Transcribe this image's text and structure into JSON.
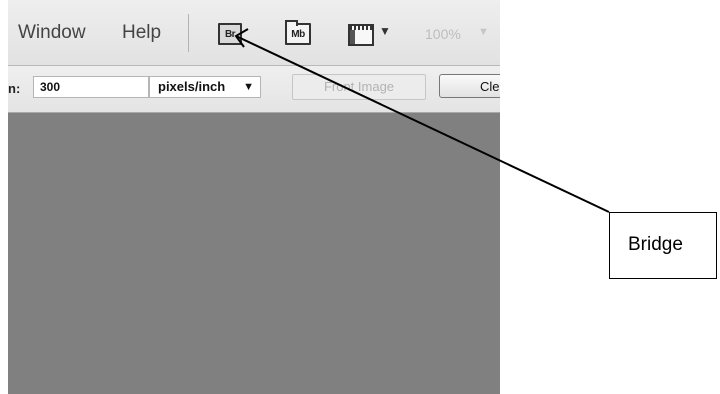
{
  "menu": {
    "window_label": "Window",
    "help_label": "Help",
    "bridge_icon_text": "Br",
    "minibridge_icon_text": "Mb",
    "screen_mode_arrow": "▼",
    "zoom_value": "100%",
    "zoom_arrow": "▼"
  },
  "options_bar": {
    "resolution_label": "n:",
    "resolution_value": "300",
    "unit_value": "pixels/inch",
    "unit_arrow": "▼",
    "front_image_label": "Front Image",
    "clear_label": "Cle"
  },
  "annotation": {
    "callout_text": "Bridge"
  },
  "colors": {
    "canvas": "#808080",
    "menubar": "#e8e8e8"
  }
}
